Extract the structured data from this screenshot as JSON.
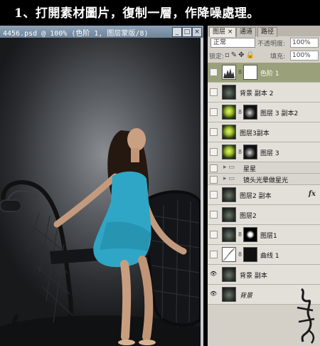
{
  "banner": {
    "text": "1、打開素材圖片，復制一層，作降噪處理。"
  },
  "document": {
    "title": "4456.psd @ 100% (色阶 1, 图层蒙版/8)",
    "minimize": "_",
    "maximize": "□",
    "close": "×"
  },
  "palette": {
    "tabs": [
      "图层 ×",
      "通道",
      "路径"
    ],
    "blend_mode": "正常",
    "opacity_label": "不透明度:",
    "opacity_value": "100%",
    "lock_label": "锁定:",
    "fill_label": "填充:",
    "fill_value": "100%",
    "layers": [
      {
        "name": "色阶 1",
        "kind": "adjust"
      },
      {
        "name": "背景 副本 2",
        "kind": "img"
      },
      {
        "name": "图层 3 副本2",
        "kind": "glow-mask"
      },
      {
        "name": "图层3副本",
        "kind": "glow"
      },
      {
        "name": "图层 3",
        "kind": "glow-mask2"
      },
      {
        "name": "星星",
        "kind": "group"
      },
      {
        "name": "镜头光晕做星光",
        "kind": "group"
      },
      {
        "name": "图层2 副本",
        "kind": "img-fx",
        "fx": "fx"
      },
      {
        "name": "图层2",
        "kind": "img"
      },
      {
        "name": "图层1",
        "kind": "img-mask"
      },
      {
        "name": "曲线 1",
        "kind": "curve"
      },
      {
        "name": "背景 副本",
        "kind": "img-eye"
      },
      {
        "name": "背景",
        "kind": "img-eye"
      }
    ],
    "visible_symbol": "👁"
  },
  "colors": {
    "selected_layer": "#9aa17a",
    "dress": "#2fa6c6"
  }
}
